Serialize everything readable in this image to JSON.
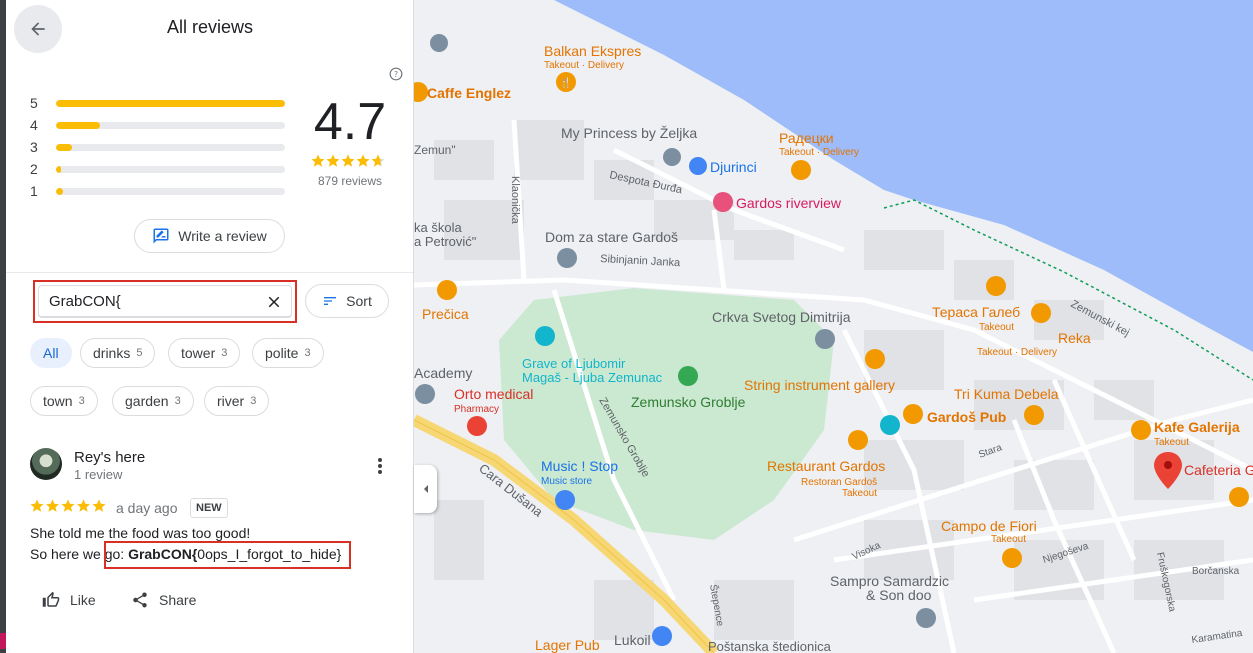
{
  "panel": {
    "title": "All reviews",
    "average": "4.7",
    "review_count": "879 reviews",
    "avg_stars_fraction": 0.94,
    "histogram": [
      {
        "star": "5",
        "fraction": 1.0
      },
      {
        "star": "4",
        "fraction": 0.19
      },
      {
        "star": "3",
        "fraction": 0.07
      },
      {
        "star": "2",
        "fraction": 0.02
      },
      {
        "star": "1",
        "fraction": 0.03
      }
    ],
    "write_review_label": "Write a review",
    "search_value": "GrabCON{",
    "sort_label": "Sort",
    "chips": [
      {
        "label": "All",
        "count": ""
      },
      {
        "label": "drinks",
        "count": "5"
      },
      {
        "label": "tower",
        "count": "3"
      },
      {
        "label": "polite",
        "count": "3"
      },
      {
        "label": "town",
        "count": "3"
      },
      {
        "label": "garden",
        "count": "3"
      },
      {
        "label": "river",
        "count": "3"
      }
    ],
    "review": {
      "author": "Rey's here",
      "author_sub": "1 review",
      "rating": 5,
      "date": "a day ago",
      "badge": "NEW",
      "line1": "She told me the food was too good!",
      "line2_prefix": "So here we go: ",
      "line2_bold": "GrabCON{",
      "line2_rest": "0ops_I_forgot_to_hide}",
      "like_label": "Like",
      "share_label": "Share"
    }
  },
  "map": {
    "labels": {
      "balkan": "Balkan Ekspres",
      "balkan_sub": "Takeout · Delivery",
      "caffe_englez": "Caffe Englez",
      "zemun_quote": "Zemun\"",
      "my_princess": "My Princess by Željka",
      "djurinci": "Djurinci",
      "radecki": "Радецки",
      "radecki_sub": "Takeout · Delivery",
      "despota": "Despota Đurđa",
      "gardos_riverview": "Gardos riverview",
      "klaonicka": "Klaonička",
      "ka_skola": "ka škola",
      "petrovic": "a Petrović\"",
      "dom_za_stare": "Dom za stare Gardoš",
      "sibinjanin": "Sibinjanin Janka",
      "precica": "Prečica",
      "terasa": "Тераса Галеб",
      "terasa_sub": "Takeout",
      "reka": "Reka",
      "reka_sub": "Takeout · Delivery",
      "zemunski_kej": "Zemunski kej",
      "crkva": "Crkva Svetog Dimitrija",
      "grave": "Grave of Ljubomir",
      "grave2": "Magaš - Ljuba Zemunac",
      "academy": "Academy",
      "orto": "Orto medical",
      "orto_sub": "Pharmacy",
      "zemunsko_groblje": "Zemunsko Groblje",
      "zemunsko_groblje_road": "Zemunsko Groblje",
      "string_gallery": "String instrument gallery",
      "tri_kuma": "Tri Kuma Debela",
      "gardos_pub": "Gardoš Pub",
      "kafe_galerija": "Kafe Galerija",
      "kafe_galerija_sub": "Takeout",
      "cafeteria": "Cafeteria G",
      "cara_dusana": "Cara Dušana",
      "music_stop": "Music ! Stop",
      "music_stop_sub": "Music store",
      "restaurant_gardos": "Restaurant Gardos",
      "restoran_gardos": "Restoran Gardoš",
      "restaurant_gardos_sub": "Takeout",
      "stara": "Stara",
      "campo": "Campo de Fiori",
      "campo_sub": "Takeout",
      "visoka": "Visoka",
      "njegoseva": "Njegoševa",
      "fruskogorska": "Fruškogorska",
      "borcanska": "Borčanska",
      "sampro": "Sampro Samardzic",
      "sampro2": "& Son doo",
      "lager_pub": "Lager Pub",
      "lukoil": "Lukoil",
      "postanska": "Poštanska štedionica",
      "stepence": "Štepence",
      "karamatina": "Karamatina"
    }
  }
}
